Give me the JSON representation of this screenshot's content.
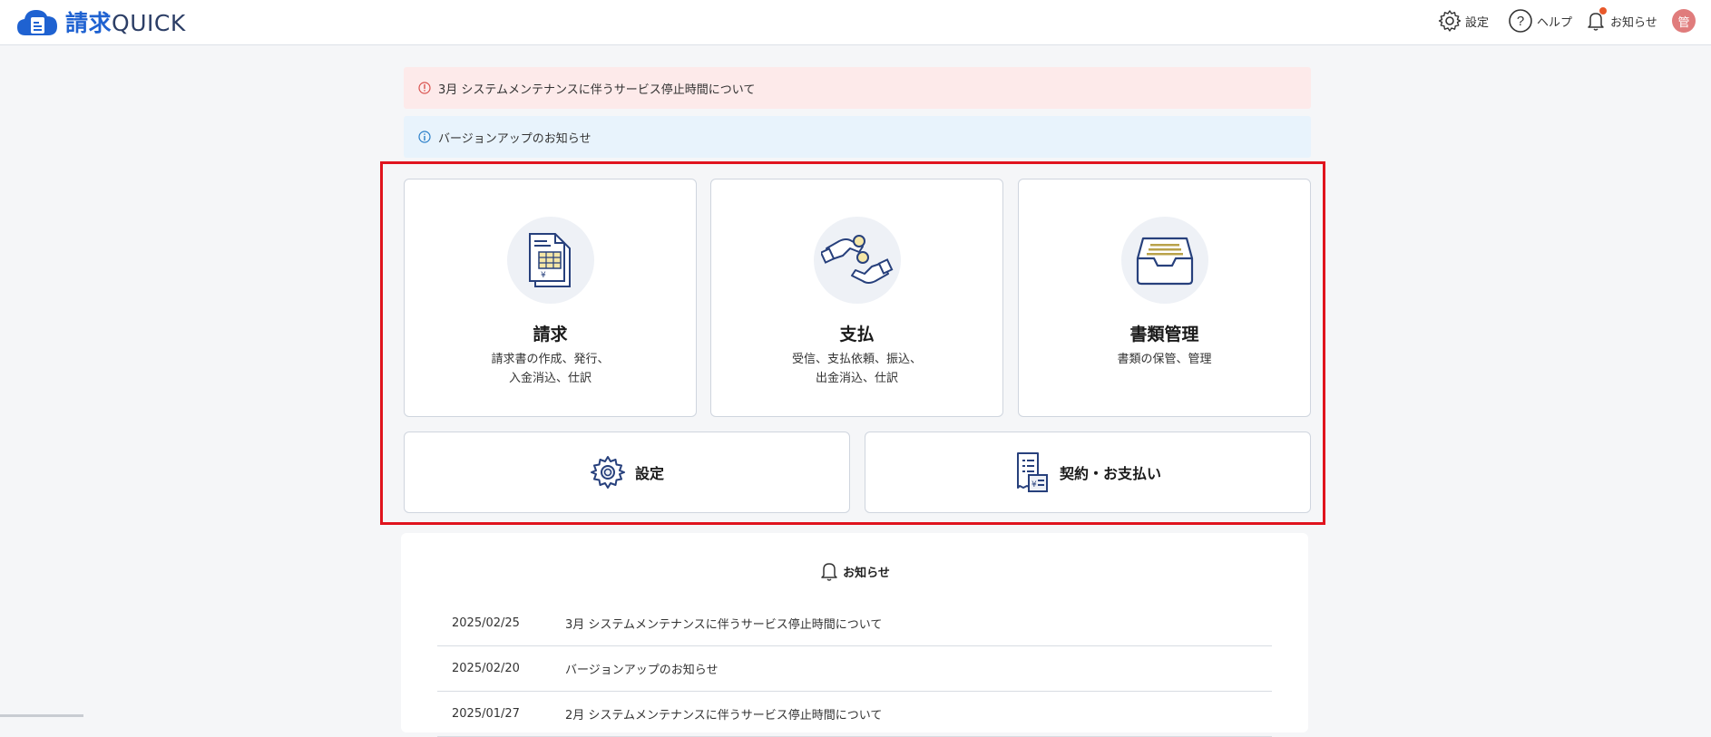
{
  "header": {
    "logo_kanji": "請求",
    "logo_latin": "QUICK",
    "settings_label": "設定",
    "help_label": "ヘルプ",
    "notifications_label": "お知らせ",
    "avatar_text": "管"
  },
  "alerts": [
    {
      "text": "3月 システムメンテナンスに伴うサービス停止時間について",
      "type": "error"
    },
    {
      "text": "バージョンアップのお知らせ",
      "type": "info"
    }
  ],
  "menu": {
    "invoice": {
      "title": "請求",
      "desc_line1": "請求書の作成、発行、",
      "desc_line2": "入金消込、仕訳",
      "icon": "invoice-document-icon"
    },
    "payment": {
      "title": "支払",
      "desc_line1": "受信、支払依頼、振込、",
      "desc_line2": "出金消込、仕訳",
      "icon": "hands-coin-icon"
    },
    "documents": {
      "title": "書類管理",
      "desc_line1": "書類の保管、管理",
      "icon": "document-tray-icon"
    },
    "settings": {
      "label": "設定",
      "icon": "gear-icon"
    },
    "contract": {
      "label": "契約・お支払い",
      "icon": "receipt-icon"
    }
  },
  "news": {
    "title": "お知らせ",
    "items": [
      {
        "date": "2025/02/25",
        "text": "3月 システムメンテナンスに伴うサービス停止時間について"
      },
      {
        "date": "2025/02/20",
        "text": "バージョンアップのお知らせ"
      },
      {
        "date": "2025/01/27",
        "text": "2月 システムメンテナンスに伴うサービス停止時間について"
      }
    ]
  },
  "colors": {
    "brand": "#1f62d1",
    "highlight_frame": "#e0141e",
    "alert_error_bg": "#fdeaea",
    "alert_info_bg": "#e8f3fc"
  }
}
